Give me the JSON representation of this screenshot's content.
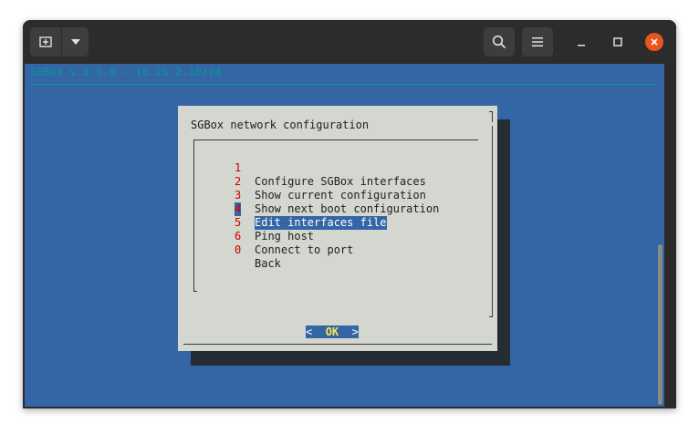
{
  "titlebar": {
    "new_tab_icon": "new-tab-icon",
    "menu_dropdown_icon": "chevron-down-icon",
    "search_icon": "search-icon",
    "hamburger_icon": "hamburger-menu-icon",
    "minimize_icon": "minimize-icon",
    "maximize_icon": "maximize-icon",
    "close_icon": "close-icon",
    "close_color": "#e95420"
  },
  "terminal": {
    "header": "SGBox v.5.5.0 - 10.25.2.10/24",
    "background": "#3465a4",
    "accent": "#06989a"
  },
  "dialog": {
    "title": "SGBox network configuration",
    "items": [
      {
        "num": "1",
        "label": "Configure SGBox interfaces"
      },
      {
        "num": "2",
        "label": "Show current configuration"
      },
      {
        "num": "3",
        "label": "Show next boot configuration"
      },
      {
        "num": "4",
        "label": "Edit interfaces file",
        "selected": true
      },
      {
        "num": "5",
        "label": "Ping host"
      },
      {
        "num": "6",
        "label": "Connect to port"
      },
      {
        "num": "0",
        "label": "Back"
      }
    ],
    "ok_left": "<",
    "ok_label": "OK",
    "ok_right": ">"
  }
}
